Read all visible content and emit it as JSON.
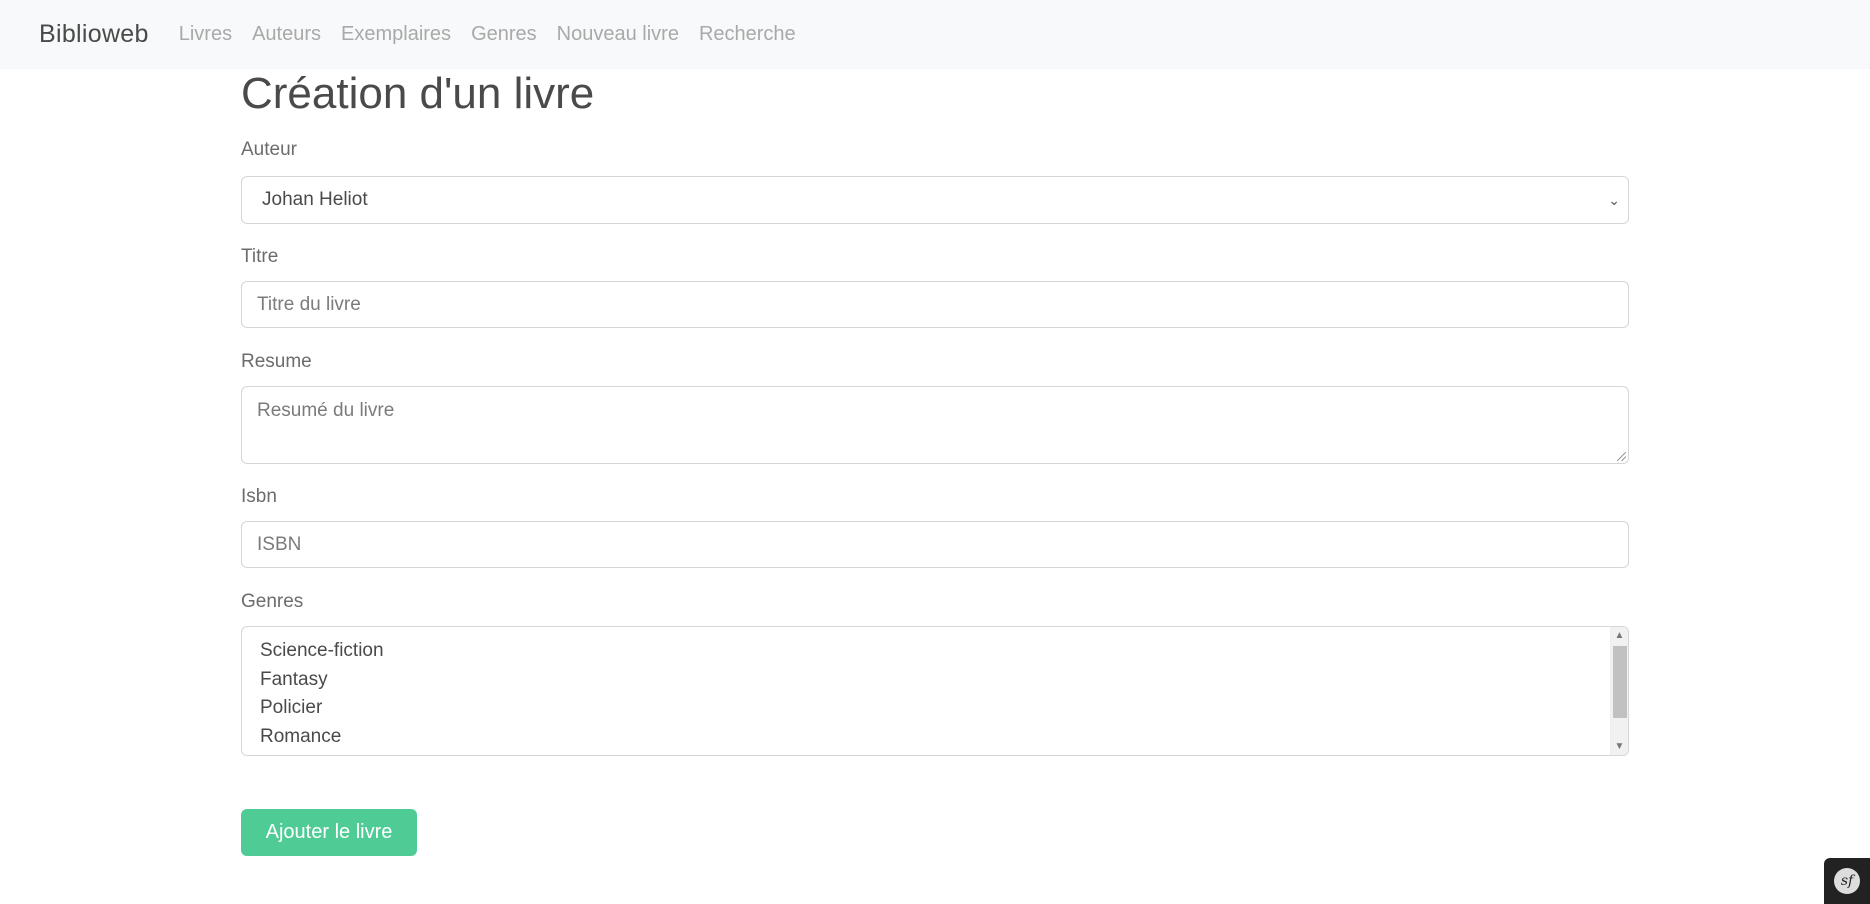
{
  "navbar": {
    "brand": "Biblioweb",
    "links": [
      "Livres",
      "Auteurs",
      "Exemplaires",
      "Genres",
      "Nouveau livre",
      "Recherche"
    ]
  },
  "page": {
    "title": "Création d'un livre"
  },
  "form": {
    "auteur": {
      "label": "Auteur",
      "selected": "Johan Heliot"
    },
    "titre": {
      "label": "Titre",
      "placeholder": "Titre du livre"
    },
    "resume": {
      "label": "Resume",
      "placeholder": "Resumé du livre"
    },
    "isbn": {
      "label": "Isbn",
      "placeholder": "ISBN"
    },
    "genres": {
      "label": "Genres",
      "options": [
        "Science-fiction",
        "Fantasy",
        "Policier",
        "Romance"
      ]
    },
    "submit_label": "Ajouter le livre"
  },
  "colors": {
    "accent": "#4fcb96",
    "navbar_bg": "#f8f9fa"
  },
  "icons": {
    "select_arrow": "chevron-down-icon",
    "toolbar": "symfony-logo-icon"
  }
}
